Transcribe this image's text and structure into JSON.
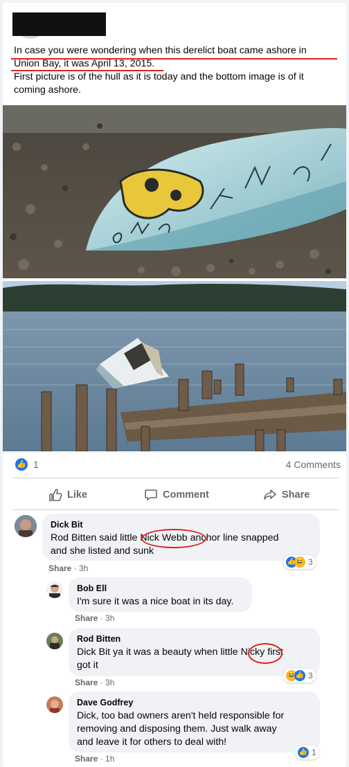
{
  "post": {
    "line1": "In case you were wondering when this derelict boat came ashore in",
    "line2": "Union Bay, it was April 13, 2015.",
    "line3": "First picture is of the hull as it is today and the bottom image is of it",
    "line4": "coming ashore."
  },
  "reactions": {
    "count": "1",
    "comments": "4 Comments"
  },
  "actions": {
    "like": "Like",
    "comment": "Comment",
    "share": "Share"
  },
  "comments": [
    {
      "name": "Dick Bit",
      "line1a": "Rod Bitten said little ",
      "line1b": "Nick Webb",
      "line1c": " anchor line snapped",
      "line2": "and she listed and sunk",
      "share": "Share",
      "time": "3h",
      "react_count": "3"
    },
    {
      "name": "Bob Ell",
      "line1": "I'm sure it was a nice boat in its day.",
      "share": "Share",
      "time": "3h"
    },
    {
      "name": "Rod Bitten",
      "line1a": "Dick Bit ya it was a beauty when little ",
      "line1b": "Nicky",
      "line1c": " first",
      "line2": "got it",
      "share": "Share",
      "time": "3h",
      "react_count": "3"
    },
    {
      "name": "Dave Godfrey",
      "line1": "Dick, too bad owners aren't held responsible for",
      "line2": "removing and disposing them. Just walk away",
      "line3": "and leave it for others to deal with!",
      "share": "Share",
      "time": "1h",
      "react_count": "1"
    }
  ],
  "colors": {
    "accent": "#1877f2",
    "annotation": "#e0201e"
  }
}
